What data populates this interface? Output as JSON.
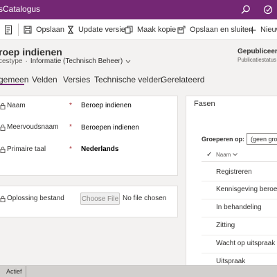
{
  "app": {
    "title": "sCatalogus",
    "icons": [
      "search-icon",
      "target-icon"
    ]
  },
  "commands": {
    "save": "Opslaan",
    "new_version": "Update versie",
    "copy": "Maak kopie",
    "save_close": "Opslaan en sluiten",
    "new": "Nieuw"
  },
  "record": {
    "title": "roep indienen",
    "entity": "cestype",
    "form_name": "Informatie (Technisch Beheer)",
    "status_value": "Gepubliceerd",
    "status_label": "Publicatiestatus"
  },
  "tabs": [
    "gemeen",
    "Velden",
    "Versies",
    "Technische velden",
    "Gerelateerd"
  ],
  "fields": {
    "name_label": "Naam",
    "name_value": "Beroep indienen",
    "plural_label": "Meervoudsnaam",
    "plural_value": "Beroepen indienen",
    "language_label": "Primaire taal",
    "language_value": "Nederlands",
    "required_marker": "*",
    "file_label": "Oplossing bestand",
    "file_button": "Choose File",
    "file_status": "No file chosen"
  },
  "phases": {
    "title": "Fasen",
    "group_label": "Groeperen op:",
    "group_value": "(geen gro",
    "column_header": "Naam",
    "check_mark": "✓",
    "items": [
      "Registreren",
      "Kennisgeving beroep",
      "In behandeling",
      "Zitting",
      "Wacht op uitspraak",
      "Uitspraak"
    ]
  },
  "status_bar": {
    "state": "Actief"
  }
}
